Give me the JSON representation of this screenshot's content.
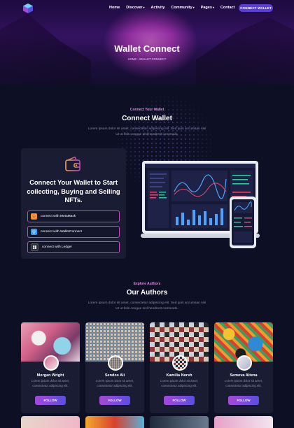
{
  "nav": {
    "links": [
      {
        "label": "Home",
        "caret": ""
      },
      {
        "label": "Discover",
        "caret": "▾"
      },
      {
        "label": "Activity",
        "caret": ""
      },
      {
        "label": "Community",
        "caret": "▾"
      },
      {
        "label": "Pages",
        "caret": "▾"
      },
      {
        "label": "Contact",
        "caret": ""
      }
    ],
    "cta": "CONNECT WALLET"
  },
  "hero": {
    "title": "Wallet Connect",
    "breadcrumb_home": "HOME",
    "breadcrumb_sep": "›",
    "breadcrumb_current": "WALLET CONNECT"
  },
  "connect": {
    "subtitle": "Connect Your Wallet",
    "title": "Connect Wallet",
    "description": "Lorem ipsum dolor sit amet, consectetur adipiscing elit. Sed quis accumsan nisi Ut ut felis congue nisl hendrerit commodo.",
    "card_title": "Connect Your Wallet to Start collecting, Buying and Selling NFTs.",
    "options": [
      {
        "label": "connect with MetaMask",
        "icon": "metamask-icon"
      },
      {
        "label": "connect with WalletConnect",
        "icon": "walletconnect-icon"
      },
      {
        "label": "connect with Ledger",
        "icon": "ledger-icon"
      }
    ]
  },
  "authors": {
    "subtitle": "Explore Authors",
    "title": "Our Authors",
    "description": "Lorem ipsum dolor sit amet, consectetur adipiscing elit. Sed quis accumsan nisi Ut ut felis congue nisl hendrerit commodo.",
    "follow_label": "FOLLOW",
    "items": [
      {
        "name": "Morgan Wright",
        "desc": "Lorem ipsum dolor sit amet, consectetur adipiscing elit."
      },
      {
        "name": "Sendos Ali",
        "desc": "Lorem ipsum dolor sit amet, consectetur adipiscing elit."
      },
      {
        "name": "Kamilia Norsh",
        "desc": "Lorem ipsum dolor sit amet, consectetur adipiscing elit."
      },
      {
        "name": "Semova Altena",
        "desc": "Lorem ipsum dolor sit amet, consectetur adipiscing elit."
      }
    ]
  },
  "colors": {
    "accent": "#c44ac0",
    "button": "#5b3fd6",
    "background": "#0d0f24",
    "card": "#1a1c33"
  }
}
